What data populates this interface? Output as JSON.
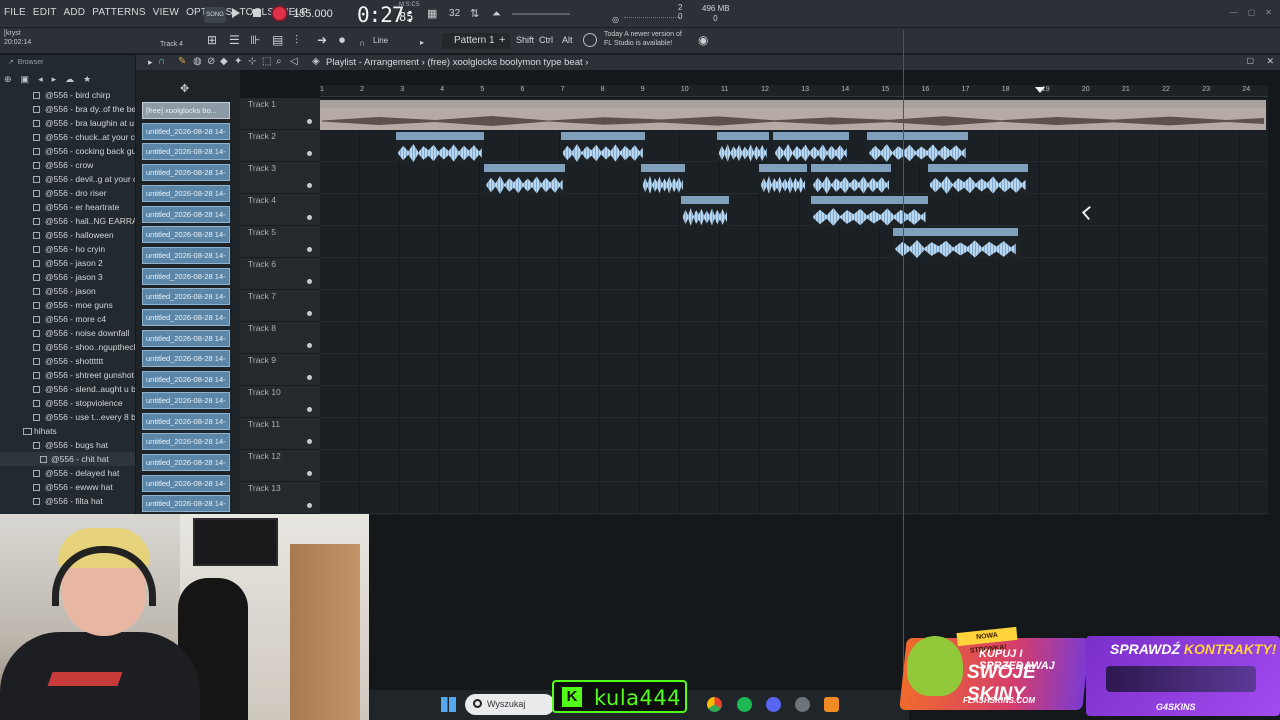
{
  "menu": [
    "FILE",
    "EDIT",
    "ADD",
    "PATTERNS",
    "VIEW",
    "OPTIONS",
    "TOOLS",
    "HELP"
  ],
  "transport": {
    "song_label": "SONG",
    "tempo": "155.000",
    "time_main": "0:27:",
    "time_sub": "85",
    "time_unit": "M:S:CS",
    "time_sig": "3",
    "cpu_value": "2",
    "cpu_sub": "0",
    "memory": "496 MB",
    "memory_sub": "0"
  },
  "toolbar2": {
    "user": "[kryst",
    "clock": "20:02:14",
    "track_hint": "Track 4",
    "line_mode": "Line",
    "pattern": "Pattern 1",
    "keys": [
      "Shift",
      "Ctrl",
      "Alt"
    ],
    "news_line1": "Today  A newer version of",
    "news_line2": "FL Studio is available!"
  },
  "browser": {
    "title": "Browser",
    "items": [
      {
        "label": "@556 - bird chirp",
        "kind": "file"
      },
      {
        "label": "@556 - bra dy..of the beat",
        "kind": "file"
      },
      {
        "label": "@556 - bra laughin at u",
        "kind": "file"
      },
      {
        "label": "@556 - chuck..at your cut",
        "kind": "file"
      },
      {
        "label": "@556 - cocking back gun",
        "kind": "file"
      },
      {
        "label": "@556 - crow",
        "kind": "file"
      },
      {
        "label": "@556 - devil..g at your cut",
        "kind": "file"
      },
      {
        "label": "@556 - dro riser",
        "kind": "file"
      },
      {
        "label": "@556 - er heartrate",
        "kind": "file"
      },
      {
        "label": "@556 - hall..NG EARRAPE)",
        "kind": "file"
      },
      {
        "label": "@556 - halloween",
        "kind": "file"
      },
      {
        "label": "@556 - ho cryin",
        "kind": "file"
      },
      {
        "label": "@556 - jason 2",
        "kind": "file"
      },
      {
        "label": "@556 - jason 3",
        "kind": "file"
      },
      {
        "label": "@556 - jason",
        "kind": "file"
      },
      {
        "label": "@556 - moe guns",
        "kind": "file"
      },
      {
        "label": "@556 - more c4",
        "kind": "file"
      },
      {
        "label": "@556 - noise downfall",
        "kind": "file"
      },
      {
        "label": "@556 - shoo..nguptheclub",
        "kind": "file"
      },
      {
        "label": "@556 - shotttttt",
        "kind": "file"
      },
      {
        "label": "@556 - shtreet gunshot",
        "kind": "file"
      },
      {
        "label": "@556 - slend..aught u bro",
        "kind": "file"
      },
      {
        "label": "@556 - stopviolence",
        "kind": "file"
      },
      {
        "label": "@556 - use t...every 8 bars",
        "kind": "file"
      },
      {
        "label": "hihats",
        "kind": "folder"
      },
      {
        "label": "@556 - bugs hat",
        "kind": "file"
      },
      {
        "label": "@556 - chit hat",
        "kind": "sub"
      },
      {
        "label": "@556 - delayed hat",
        "kind": "file"
      },
      {
        "label": "@556 - ewww hat",
        "kind": "file"
      },
      {
        "label": "@556 - filta hat",
        "kind": "file"
      }
    ]
  },
  "picker": [
    "[free] xoolglocks bo...",
    "untitled_2026-08-28 14-",
    "untitled_2026-08-28 14-",
    "untitled_2026-08-28 14-",
    "untitled_2026-08-28 14-",
    "untitled_2026-08-28 14-",
    "untitled_2026-08-28 14-",
    "untitled_2026-08-28 14-",
    "untitled_2026-08-28 14-",
    "untitled_2026-08-28 14-",
    "untitled_2026-08-28 14-",
    "untitled_2026-08-28 14-",
    "untitled_2026-08-28 14-",
    "untitled_2026-08-28 14-",
    "untitled_2026-08-28 14-",
    "untitled_2026-08-28 14-",
    "untitled_2026-08-28 14-",
    "untitled_2026-08-28 14-",
    "untitled_2026-08-28 14-",
    "untitled_2026-08-28 14-"
  ],
  "playlist": {
    "title_prefix": "Playlist - Arrangement",
    "title_song": "(free) xoolglocks boolymon type beat",
    "ruler": [
      "1",
      "2",
      "3",
      "4",
      "5",
      "6",
      "7",
      "8",
      "9",
      "10",
      "11",
      "12",
      "13",
      "14",
      "15",
      "16",
      "17",
      "18",
      "19",
      "20",
      "21",
      "22",
      "23",
      "24"
    ],
    "tracks": [
      "Track 1",
      "Track 2",
      "Track 3",
      "Track 4",
      "Track 5",
      "Track 6",
      "Track 7",
      "Track 8",
      "Track 9",
      "Track 10",
      "Track 11",
      "Track 12",
      "Track 13"
    ],
    "clips": [
      {
        "track": 0,
        "start": 1,
        "length": 23.6,
        "label": "(free) xoolglocks boolymon type beat",
        "audio": true
      },
      {
        "track": 1,
        "start": 2.9,
        "length": 2.2,
        "label": "untitled_202..olymon Main"
      },
      {
        "track": 1,
        "start": 7.0,
        "length": 2.1,
        "label": "untitled_20..lymon Main"
      },
      {
        "track": 1,
        "start": 10.9,
        "length": 1.3,
        "label": "untitl...n Main"
      },
      {
        "track": 1,
        "start": 12.3,
        "length": 1.9,
        "label": "untitled_..ymon Main"
      },
      {
        "track": 1,
        "start": 14.65,
        "length": 2.5,
        "label": "untitled_2026..Boolymon Main"
      },
      {
        "track": 2,
        "start": 5.1,
        "length": 2.0,
        "label": "untitled_2..lymon Main"
      },
      {
        "track": 2,
        "start": 9.0,
        "length": 1.1,
        "label": "untit..Main"
      },
      {
        "track": 2,
        "start": 11.95,
        "length": 1.2,
        "label": "untitl...Main"
      },
      {
        "track": 2,
        "start": 13.25,
        "length": 2.0,
        "label": "untitled_20..lymon Main"
      },
      {
        "track": 2,
        "start": 16.15,
        "length": 2.5,
        "label": "untitled_2026..oolymon Main"
      },
      {
        "track": 3,
        "start": 10.0,
        "length": 1.2,
        "label": "untitl...Main"
      },
      {
        "track": 3,
        "start": 13.25,
        "length": 2.9,
        "label": "untitled_2026-0...) Boolymon Main"
      },
      {
        "track": 4,
        "start": 15.3,
        "length": 3.1,
        "label": "untitled_2026-08...m) Boolymon Main"
      }
    ]
  },
  "taskbar": {
    "search_placeholder": "Wyszukaj"
  },
  "overlay": {
    "kick_name": "kula444",
    "ad1_badge": "NOWA STRONKA!",
    "ad1_line1": "KUPUJ I SPRZEDAWAJ",
    "ad1_line2": "SWOJE SKINY",
    "ad1_brand": "FLASHSKINS.COM",
    "ad2_title_a": "SPRAWDŹ ",
    "ad2_title_b": "KONTRAKTY!",
    "ad2_brand": "G4SKINS"
  },
  "colors": {
    "clip_header": "#7f9fbd",
    "clip_wave": "#b9d6ef",
    "audio_clip": "#b5aaa6",
    "record": "#e0304a",
    "kick_green": "#53fc18"
  }
}
